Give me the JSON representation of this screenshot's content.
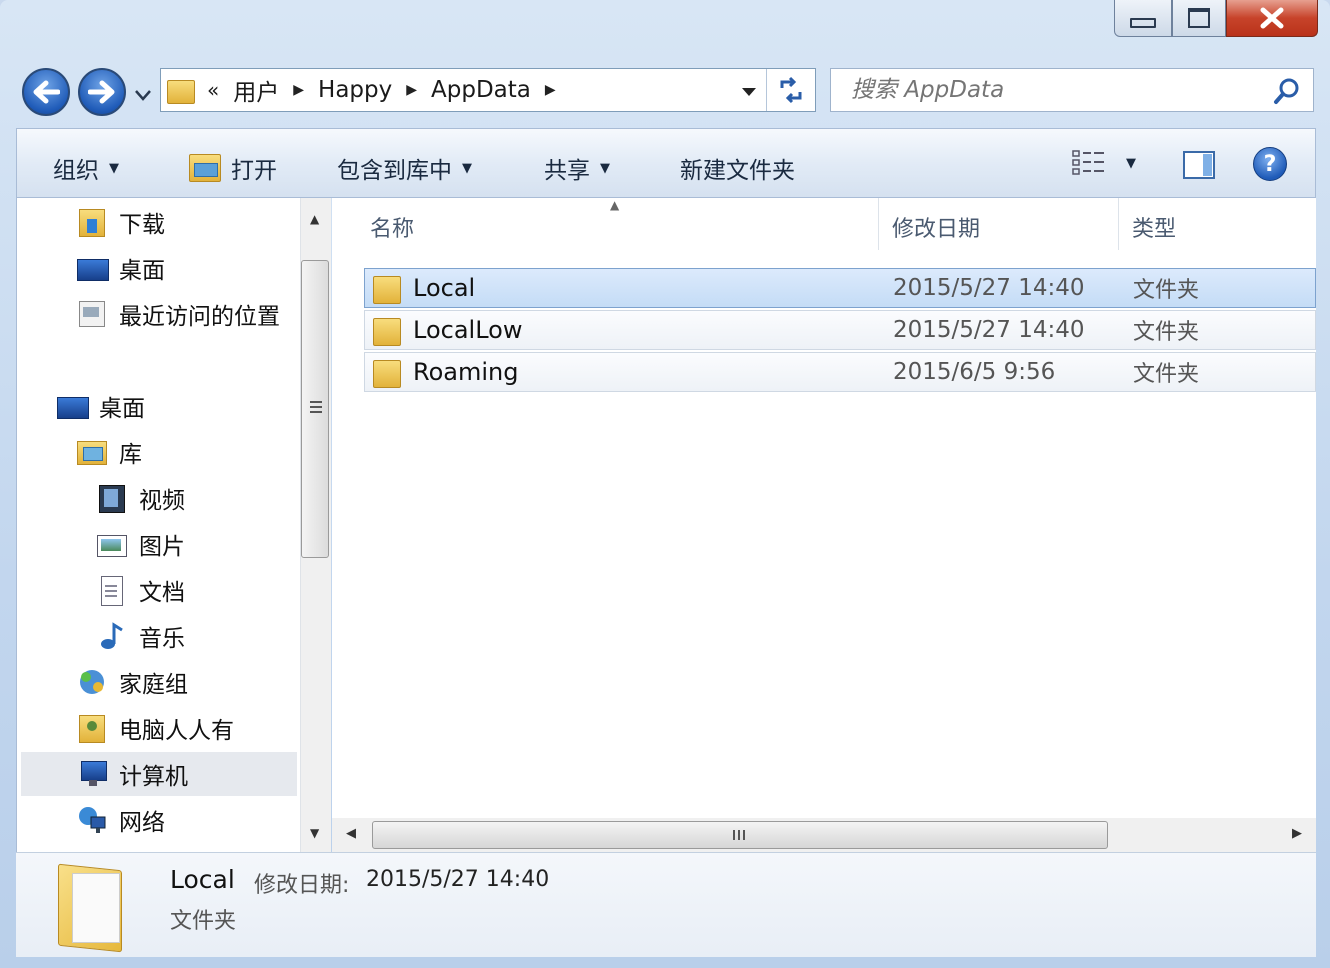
{
  "breadcrumb": {
    "overflow": "«",
    "items": [
      "用户",
      "Happy",
      "AppData"
    ]
  },
  "search": {
    "placeholder": "搜索 AppData"
  },
  "toolbar": {
    "organize": "组织",
    "open": "打开",
    "include_in_library": "包含到库中",
    "share": "共享",
    "new_folder": "新建文件夹"
  },
  "sidebar": {
    "favorites": [
      "下载",
      "桌面",
      "最近访问的位置"
    ],
    "tree": {
      "desktop": "桌面",
      "library": "库",
      "library_items": [
        "视频",
        "图片",
        "文档",
        "音乐"
      ],
      "homegroup": "家庭组",
      "user": "电脑人人有",
      "computer": "计算机",
      "network": "网络"
    }
  },
  "columns": {
    "name": "名称",
    "modified": "修改日期",
    "type": "类型"
  },
  "files": [
    {
      "name": "Local",
      "modified": "2015/5/27 14:40",
      "type": "文件夹"
    },
    {
      "name": "LocalLow",
      "modified": "2015/5/27 14:40",
      "type": "文件夹"
    },
    {
      "name": "Roaming",
      "modified": "2015/6/5 9:56",
      "type": "文件夹"
    }
  ],
  "details": {
    "name": "Local",
    "modified_label": "修改日期:",
    "modified": "2015/5/27 14:40",
    "type": "文件夹"
  },
  "colors": {
    "folder_yellow": "#f3c94d",
    "selection_blue": "#c4dcf6",
    "close_red": "#c7432a",
    "nav_blue": "#1f5bb8"
  }
}
